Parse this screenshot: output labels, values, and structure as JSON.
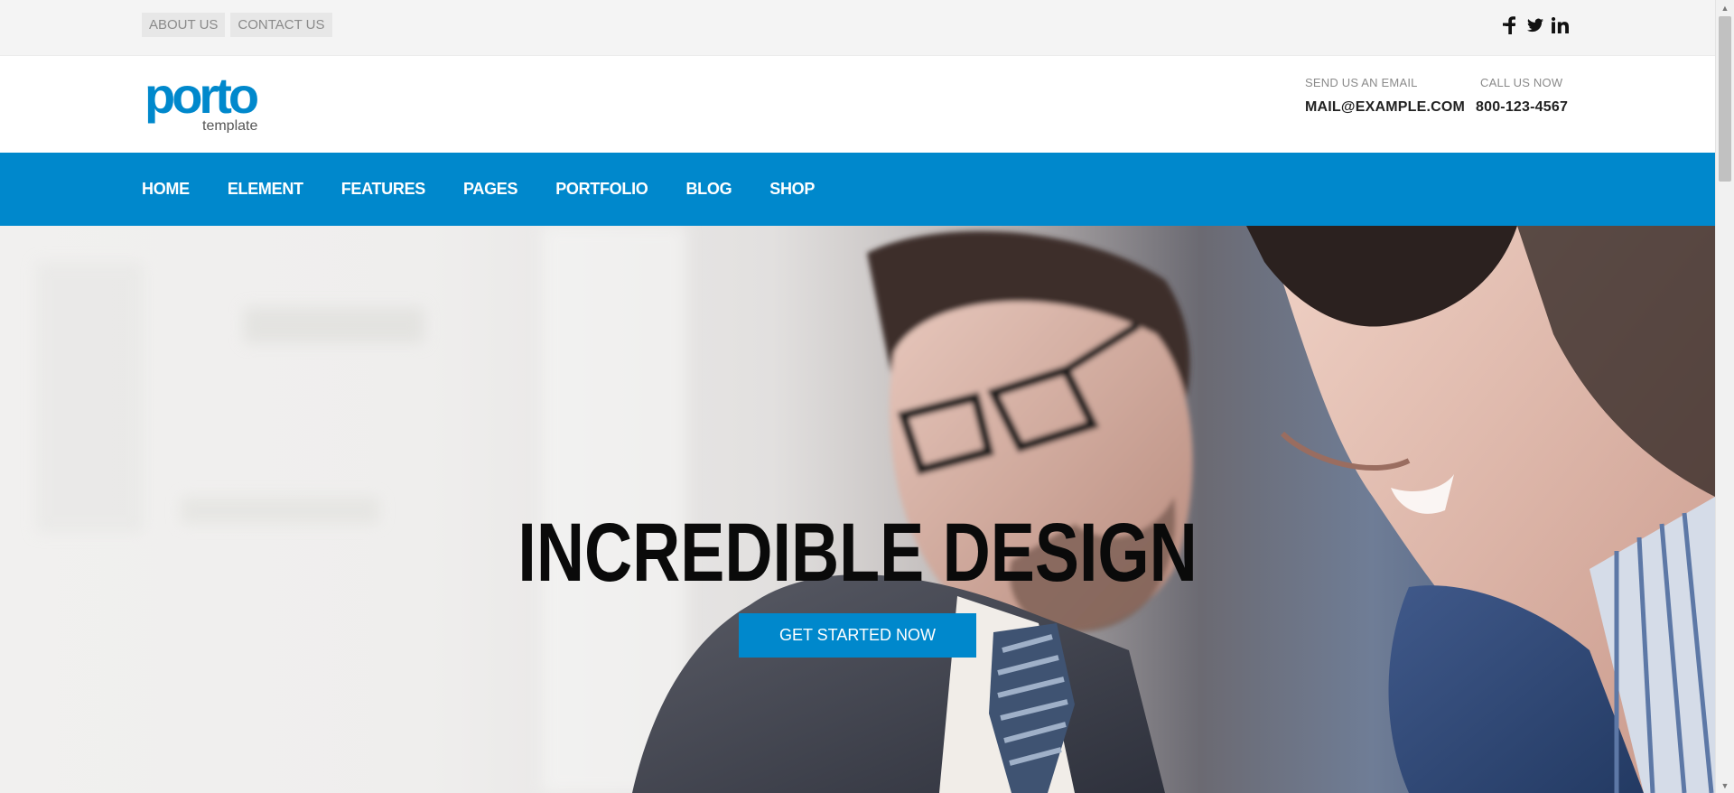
{
  "topbar": {
    "links": [
      {
        "label": "ABOUT US"
      },
      {
        "label": "CONTACT US"
      }
    ],
    "social": [
      {
        "icon": "facebook-icon"
      },
      {
        "icon": "twitter-icon"
      },
      {
        "icon": "linkedin-icon"
      }
    ]
  },
  "header": {
    "logo": {
      "word": "porto",
      "subtitle": "template"
    },
    "email": {
      "label": "SEND US AN EMAIL",
      "value": "MAIL@EXAMPLE.COM"
    },
    "phone": {
      "label": "CALL US NOW",
      "value": "800-123-4567"
    }
  },
  "nav": {
    "items": [
      {
        "label": "HOME"
      },
      {
        "label": "ELEMENT"
      },
      {
        "label": "FEATURES"
      },
      {
        "label": "PAGES"
      },
      {
        "label": "PORTFOLIO"
      },
      {
        "label": "BLOG"
      },
      {
        "label": "SHOP"
      }
    ]
  },
  "hero": {
    "title": "INCREDIBLE DESIGN",
    "cta": "GET STARTED NOW"
  },
  "colors": {
    "accent": "#0088cc",
    "topbar_bg": "#f4f4f4",
    "text_dark": "#222222"
  }
}
